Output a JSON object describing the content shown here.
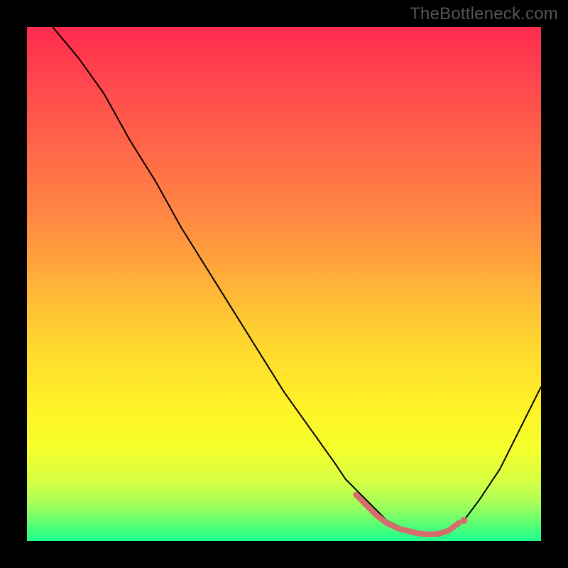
{
  "watermark": "TheBottleneck.com",
  "chart_data": {
    "type": "line",
    "title": "",
    "xlabel": "",
    "ylabel": "",
    "xlim": [
      0,
      100
    ],
    "ylim": [
      0,
      100
    ],
    "series": [
      {
        "name": "curve",
        "x": [
          5,
          10,
          15,
          20,
          25,
          30,
          35,
          40,
          45,
          50,
          55,
          60,
          62,
          64,
          66,
          68,
          70,
          72,
          74,
          76,
          78,
          80,
          82,
          85,
          88,
          92,
          96,
          100
        ],
        "y": [
          100,
          94,
          87,
          78,
          70,
          61,
          53,
          45,
          37,
          29,
          22,
          15,
          12,
          10,
          8,
          6,
          4,
          3,
          2,
          1.5,
          1.2,
          1.3,
          2,
          4,
          8,
          14,
          22,
          30
        ]
      },
      {
        "name": "highlight-region",
        "x": [
          64,
          66,
          68,
          70,
          72,
          74,
          76,
          78,
          80,
          82,
          84
        ],
        "y": [
          9,
          7,
          5,
          3.5,
          2.5,
          2,
          1.5,
          1.3,
          1.4,
          2,
          3.5
        ]
      }
    ],
    "annotations": [
      {
        "type": "dot",
        "x": 85,
        "y": 4
      }
    ],
    "background_gradient": {
      "stops": [
        {
          "offset": 0.0,
          "color": "#ff2b4f"
        },
        {
          "offset": 0.12,
          "color": "#ff4a4d"
        },
        {
          "offset": 0.25,
          "color": "#ff6a48"
        },
        {
          "offset": 0.38,
          "color": "#ff8a42"
        },
        {
          "offset": 0.5,
          "color": "#ffb239"
        },
        {
          "offset": 0.62,
          "color": "#ffd82f"
        },
        {
          "offset": 0.74,
          "color": "#fff227"
        },
        {
          "offset": 0.82,
          "color": "#f6ff2b"
        },
        {
          "offset": 0.88,
          "color": "#d8ff42"
        },
        {
          "offset": 0.92,
          "color": "#b0ff55"
        },
        {
          "offset": 0.95,
          "color": "#7dff68"
        },
        {
          "offset": 0.975,
          "color": "#49ff7b"
        },
        {
          "offset": 1.0,
          "color": "#1cff8c"
        }
      ]
    }
  }
}
